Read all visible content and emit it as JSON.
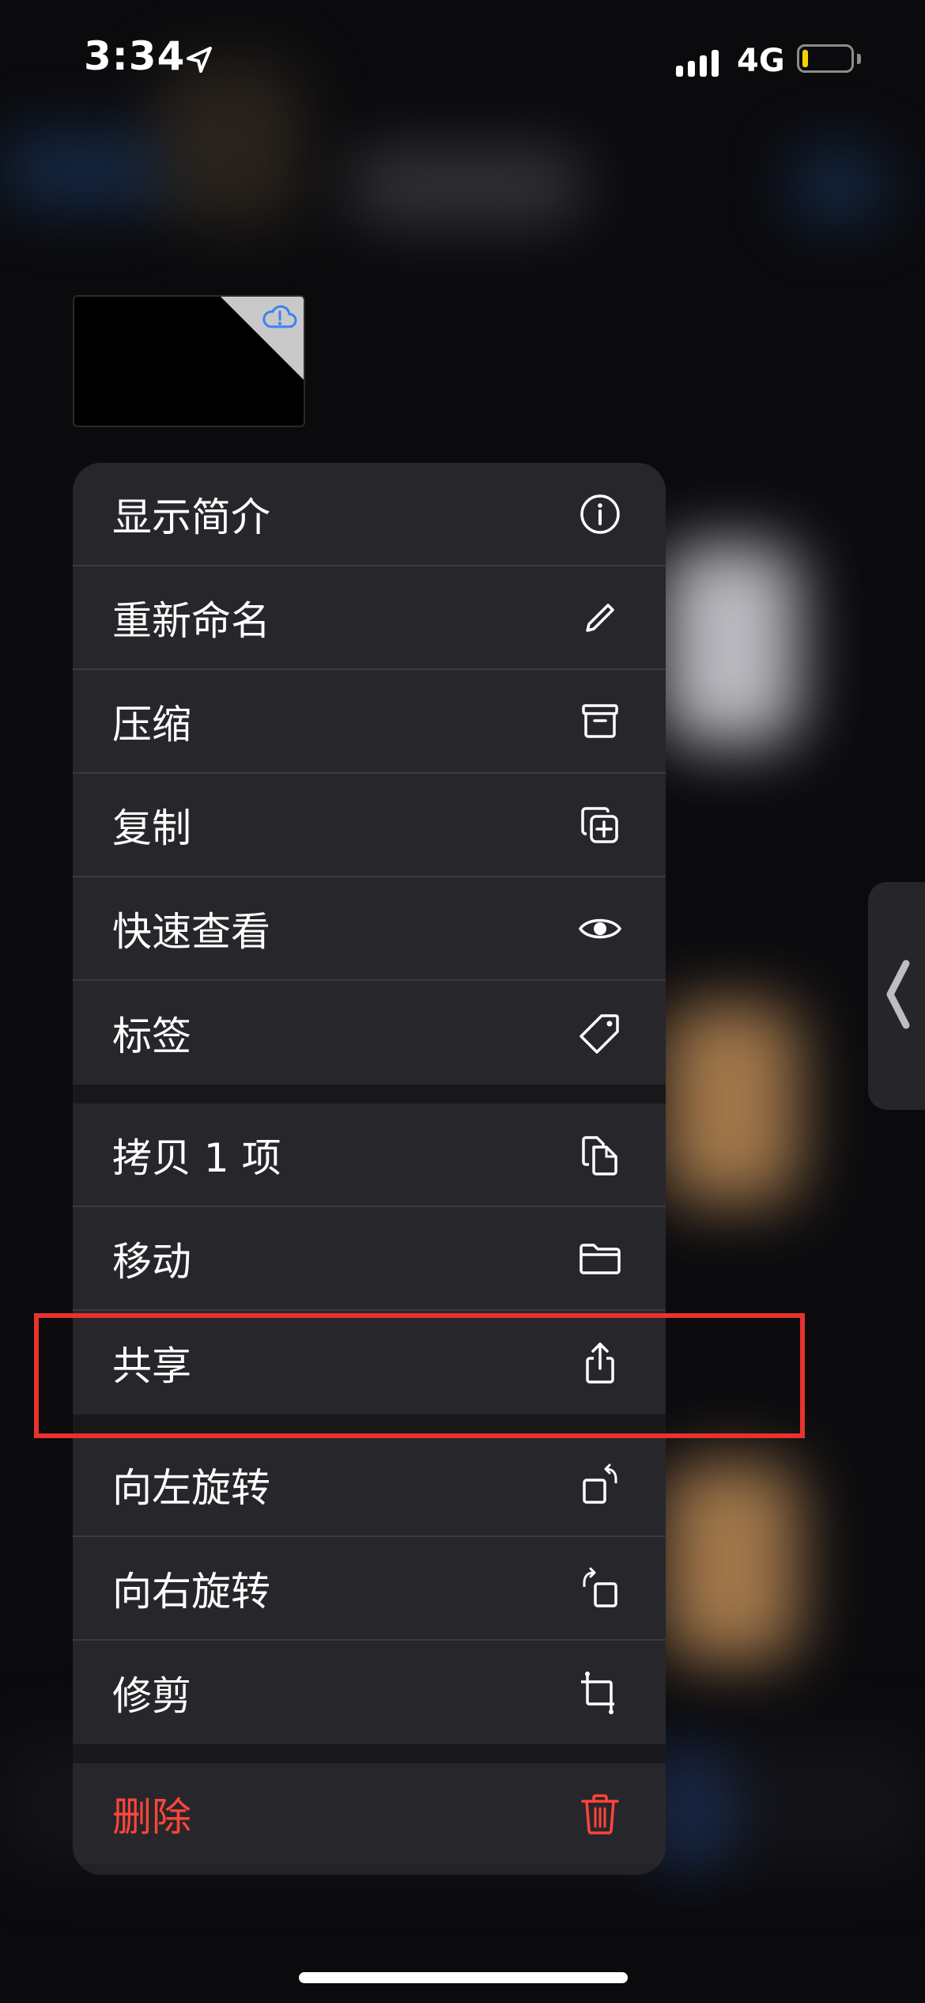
{
  "status_bar": {
    "time": "3:34",
    "network": "4G",
    "battery_level": 0.12,
    "battery_color": "#f7d200"
  },
  "thumbnail": {
    "icon": "icloud-warning-icon",
    "icon_color": "#3b82f6"
  },
  "menu": {
    "groups": [
      [
        {
          "label": "显示简介",
          "icon": "info-icon"
        },
        {
          "label": "重新命名",
          "icon": "pencil-icon"
        },
        {
          "label": "压缩",
          "icon": "archive-box-icon"
        },
        {
          "label": "复制",
          "icon": "duplicate-plus-icon"
        },
        {
          "label": "快速查看",
          "icon": "eye-icon"
        },
        {
          "label": "标签",
          "icon": "tag-icon"
        }
      ],
      [
        {
          "label": "拷贝 1 项",
          "icon": "copy-documents-icon"
        },
        {
          "label": "移动",
          "icon": "folder-icon"
        },
        {
          "label": "共享",
          "icon": "share-icon"
        }
      ],
      [
        {
          "label": "向左旋转",
          "icon": "rotate-left-icon"
        },
        {
          "label": "向右旋转",
          "icon": "rotate-right-icon"
        },
        {
          "label": "修剪",
          "icon": "crop-icon"
        }
      ],
      [
        {
          "label": "删除",
          "icon": "trash-icon",
          "destructive": true
        }
      ]
    ],
    "destructive_color": "#ff453a"
  },
  "highlight": {
    "target": "共享",
    "color": "#e8332c"
  }
}
